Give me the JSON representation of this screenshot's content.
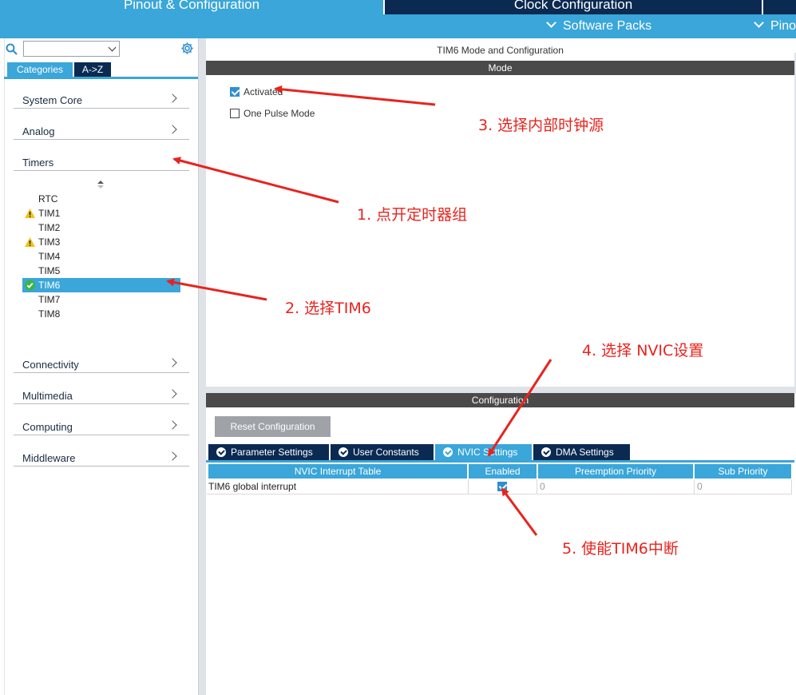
{
  "top_tabs": {
    "pinout": "Pinout & Configuration",
    "clock": "Clock Configuration"
  },
  "sub_bar": {
    "software_packs": "Software Packs",
    "pinout": "Pinout"
  },
  "left": {
    "search_value": "",
    "tab_categories": "Categories",
    "tab_az": "A->Z",
    "categories": [
      "System Core",
      "Analog",
      "Timers",
      "Connectivity",
      "Multimedia",
      "Computing",
      "Middleware"
    ],
    "timers": [
      {
        "name": "RTC",
        "status": "none"
      },
      {
        "name": "TIM1",
        "status": "warning"
      },
      {
        "name": "TIM2",
        "status": "none"
      },
      {
        "name": "TIM3",
        "status": "warning"
      },
      {
        "name": "TIM4",
        "status": "none"
      },
      {
        "name": "TIM5",
        "status": "none"
      },
      {
        "name": "TIM6",
        "status": "ok",
        "selected": true
      },
      {
        "name": "TIM7",
        "status": "none"
      },
      {
        "name": "TIM8",
        "status": "none"
      }
    ]
  },
  "mode": {
    "title": "TIM6 Mode and Configuration",
    "section": "Mode",
    "activated_label": "Activated",
    "activated_checked": true,
    "one_pulse_label": "One Pulse Mode",
    "one_pulse_checked": false
  },
  "config": {
    "section": "Configuration",
    "reset_button": "Reset Configuration",
    "tabs": [
      "Parameter Settings",
      "User Constants",
      "NVIC Settings",
      "DMA Settings"
    ],
    "active_tab": "NVIC Settings",
    "table": {
      "headers": [
        "NVIC Interrupt Table",
        "Enabled",
        "Preemption Priority",
        "Sub Priority"
      ],
      "rows": [
        {
          "name": "TIM6 global interrupt",
          "enabled": true,
          "preemption": "0",
          "sub": "0"
        }
      ]
    }
  },
  "annotations": {
    "step1": "1. 点开定时器组",
    "step2": "2. 选择TIM6",
    "step3": "3. 选择内部时钟源",
    "step4": "4. 选择 NVIC设置",
    "step5": "5. 使能TIM6中断"
  },
  "colors": {
    "accent": "#3aa6d9",
    "navy": "#0a2a52",
    "annotation": "#e8231e"
  }
}
